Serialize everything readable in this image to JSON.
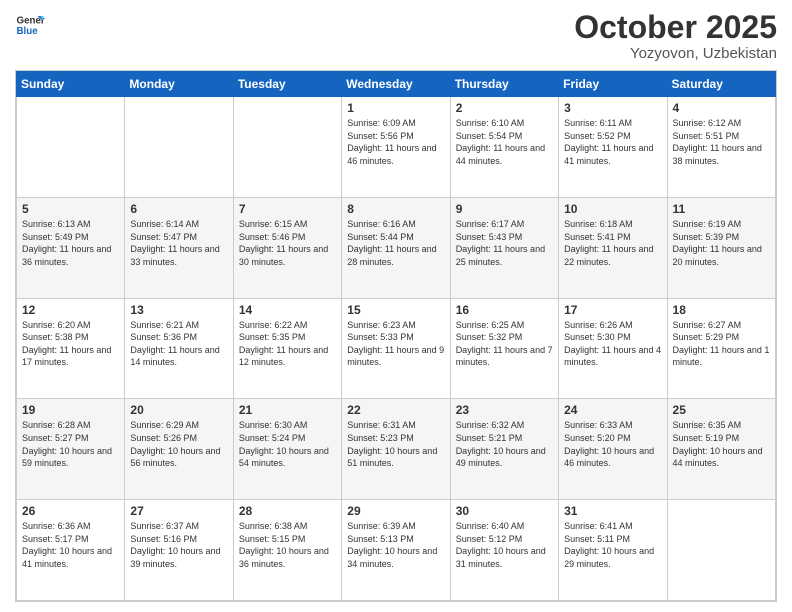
{
  "logo": {
    "line1": "General",
    "line2": "Blue"
  },
  "title": "October 2025",
  "location": "Yozyovon, Uzbekistan",
  "days_of_week": [
    "Sunday",
    "Monday",
    "Tuesday",
    "Wednesday",
    "Thursday",
    "Friday",
    "Saturday"
  ],
  "weeks": [
    [
      null,
      null,
      null,
      {
        "day": 1,
        "sunrise": "6:09 AM",
        "sunset": "5:56 PM",
        "daylight": "11 hours and 46 minutes."
      },
      {
        "day": 2,
        "sunrise": "6:10 AM",
        "sunset": "5:54 PM",
        "daylight": "11 hours and 44 minutes."
      },
      {
        "day": 3,
        "sunrise": "6:11 AM",
        "sunset": "5:52 PM",
        "daylight": "11 hours and 41 minutes."
      },
      {
        "day": 4,
        "sunrise": "6:12 AM",
        "sunset": "5:51 PM",
        "daylight": "11 hours and 38 minutes."
      }
    ],
    [
      {
        "day": 5,
        "sunrise": "6:13 AM",
        "sunset": "5:49 PM",
        "daylight": "11 hours and 36 minutes."
      },
      {
        "day": 6,
        "sunrise": "6:14 AM",
        "sunset": "5:47 PM",
        "daylight": "11 hours and 33 minutes."
      },
      {
        "day": 7,
        "sunrise": "6:15 AM",
        "sunset": "5:46 PM",
        "daylight": "11 hours and 30 minutes."
      },
      {
        "day": 8,
        "sunrise": "6:16 AM",
        "sunset": "5:44 PM",
        "daylight": "11 hours and 28 minutes."
      },
      {
        "day": 9,
        "sunrise": "6:17 AM",
        "sunset": "5:43 PM",
        "daylight": "11 hours and 25 minutes."
      },
      {
        "day": 10,
        "sunrise": "6:18 AM",
        "sunset": "5:41 PM",
        "daylight": "11 hours and 22 minutes."
      },
      {
        "day": 11,
        "sunrise": "6:19 AM",
        "sunset": "5:39 PM",
        "daylight": "11 hours and 20 minutes."
      }
    ],
    [
      {
        "day": 12,
        "sunrise": "6:20 AM",
        "sunset": "5:38 PM",
        "daylight": "11 hours and 17 minutes."
      },
      {
        "day": 13,
        "sunrise": "6:21 AM",
        "sunset": "5:36 PM",
        "daylight": "11 hours and 14 minutes."
      },
      {
        "day": 14,
        "sunrise": "6:22 AM",
        "sunset": "5:35 PM",
        "daylight": "11 hours and 12 minutes."
      },
      {
        "day": 15,
        "sunrise": "6:23 AM",
        "sunset": "5:33 PM",
        "daylight": "11 hours and 9 minutes."
      },
      {
        "day": 16,
        "sunrise": "6:25 AM",
        "sunset": "5:32 PM",
        "daylight": "11 hours and 7 minutes."
      },
      {
        "day": 17,
        "sunrise": "6:26 AM",
        "sunset": "5:30 PM",
        "daylight": "11 hours and 4 minutes."
      },
      {
        "day": 18,
        "sunrise": "6:27 AM",
        "sunset": "5:29 PM",
        "daylight": "11 hours and 1 minute."
      }
    ],
    [
      {
        "day": 19,
        "sunrise": "6:28 AM",
        "sunset": "5:27 PM",
        "daylight": "10 hours and 59 minutes."
      },
      {
        "day": 20,
        "sunrise": "6:29 AM",
        "sunset": "5:26 PM",
        "daylight": "10 hours and 56 minutes."
      },
      {
        "day": 21,
        "sunrise": "6:30 AM",
        "sunset": "5:24 PM",
        "daylight": "10 hours and 54 minutes."
      },
      {
        "day": 22,
        "sunrise": "6:31 AM",
        "sunset": "5:23 PM",
        "daylight": "10 hours and 51 minutes."
      },
      {
        "day": 23,
        "sunrise": "6:32 AM",
        "sunset": "5:21 PM",
        "daylight": "10 hours and 49 minutes."
      },
      {
        "day": 24,
        "sunrise": "6:33 AM",
        "sunset": "5:20 PM",
        "daylight": "10 hours and 46 minutes."
      },
      {
        "day": 25,
        "sunrise": "6:35 AM",
        "sunset": "5:19 PM",
        "daylight": "10 hours and 44 minutes."
      }
    ],
    [
      {
        "day": 26,
        "sunrise": "6:36 AM",
        "sunset": "5:17 PM",
        "daylight": "10 hours and 41 minutes."
      },
      {
        "day": 27,
        "sunrise": "6:37 AM",
        "sunset": "5:16 PM",
        "daylight": "10 hours and 39 minutes."
      },
      {
        "day": 28,
        "sunrise": "6:38 AM",
        "sunset": "5:15 PM",
        "daylight": "10 hours and 36 minutes."
      },
      {
        "day": 29,
        "sunrise": "6:39 AM",
        "sunset": "5:13 PM",
        "daylight": "10 hours and 34 minutes."
      },
      {
        "day": 30,
        "sunrise": "6:40 AM",
        "sunset": "5:12 PM",
        "daylight": "10 hours and 31 minutes."
      },
      {
        "day": 31,
        "sunrise": "6:41 AM",
        "sunset": "5:11 PM",
        "daylight": "10 hours and 29 minutes."
      },
      null
    ]
  ]
}
